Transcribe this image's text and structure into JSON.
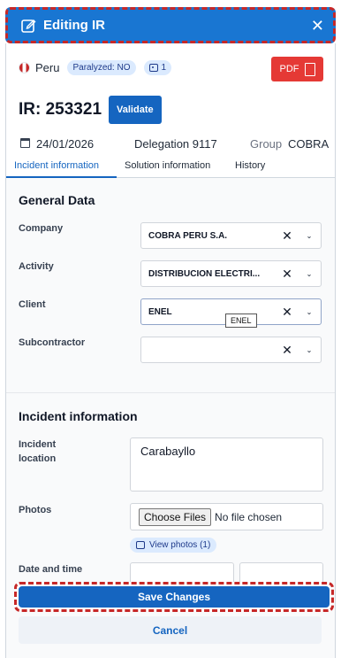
{
  "header": {
    "title": "Editing IR",
    "close_icon": "close-icon",
    "edit_icon": "edit-icon"
  },
  "meta": {
    "country": "Peru",
    "paralyzed": "Paralyzed: NO",
    "image_count": "1",
    "pdf_label": "PDF"
  },
  "ir": {
    "title": "IR: 253321",
    "validate_label": "Validate"
  },
  "info": {
    "date": "24/01/2026",
    "delegation": "Delegation 9117",
    "group_label": "Group",
    "group_value": "COBRA"
  },
  "tabs": [
    {
      "label": "Incident information",
      "active": true
    },
    {
      "label": "Solution information",
      "active": false
    },
    {
      "label": "History",
      "active": false
    }
  ],
  "general": {
    "heading": "General Data",
    "fields": [
      {
        "label": "Company",
        "value": "COBRA PERU S.A."
      },
      {
        "label": "Activity",
        "value": "DISTRIBUCION ELECTRI..."
      },
      {
        "label": "Client",
        "value": "ENEL"
      },
      {
        "label": "Subcontractor",
        "value": ""
      }
    ],
    "tooltip": "ENEL"
  },
  "incident": {
    "heading": "Incident information",
    "location_label": "Incident location",
    "location_value": "Carabayllo",
    "photos_label": "Photos",
    "choose_files": "Choose Files",
    "no_file": "No file chosen",
    "view_photos": "View photos (1)",
    "datetime_label": "Date and time"
  },
  "actions": {
    "save": "Save Changes",
    "cancel": "Cancel"
  },
  "colors": {
    "primary": "#1565c0",
    "header": "#1976d2",
    "pdf": "#e53935",
    "highlight": "#c62828"
  }
}
